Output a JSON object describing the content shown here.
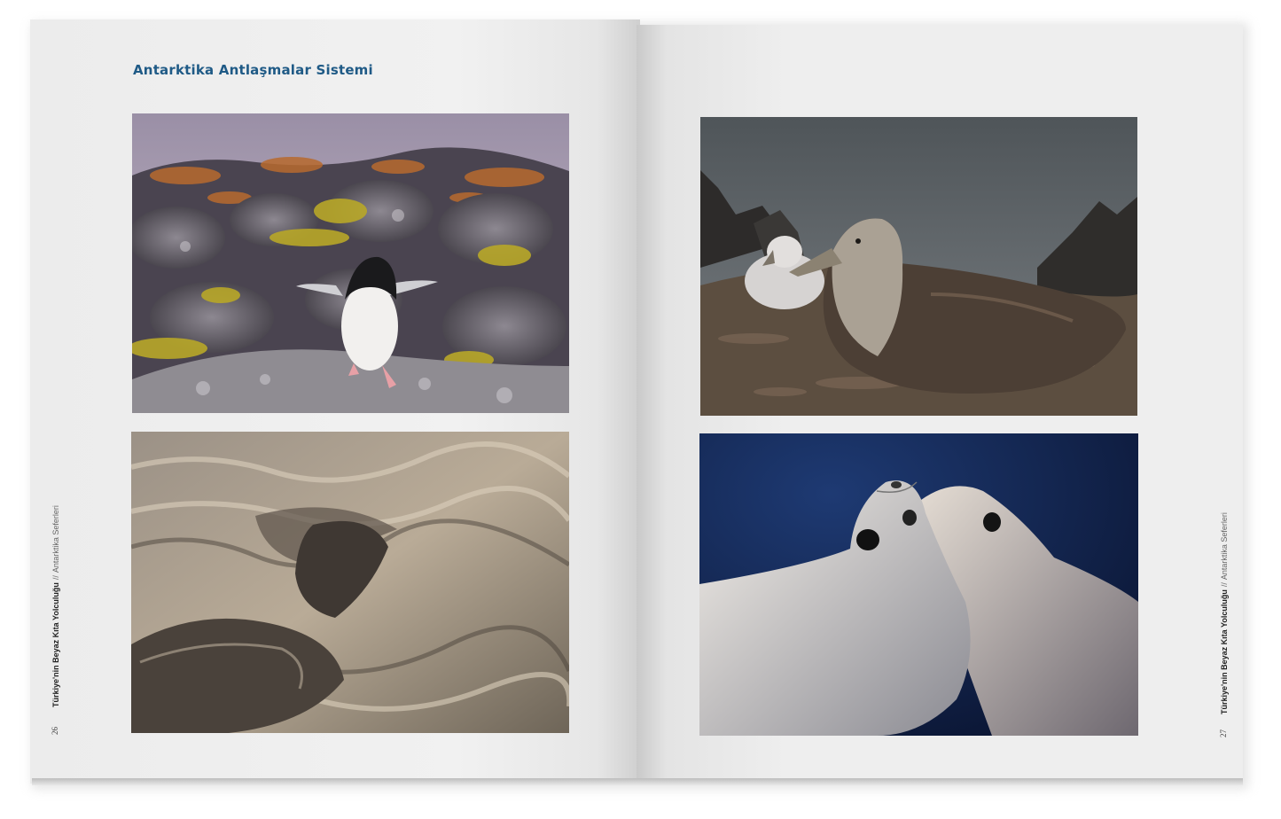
{
  "book": {
    "section_title": "Antarktika Antlaşmalar Sistemi",
    "running_title": "Türkiye'nin Beyaz Kıta Yolculuğu",
    "separator": "//",
    "running_subtitle": "Antarktika Seferleri",
    "left_page_number": "26",
    "right_page_number": "27"
  },
  "photos": [
    {
      "subject": "adelie-penguin-on-lichen-rocks"
    },
    {
      "subject": "seal-in-rippled-water"
    },
    {
      "subject": "giant-petrel-with-chick"
    },
    {
      "subject": "two-seals-nuzzling"
    }
  ]
}
